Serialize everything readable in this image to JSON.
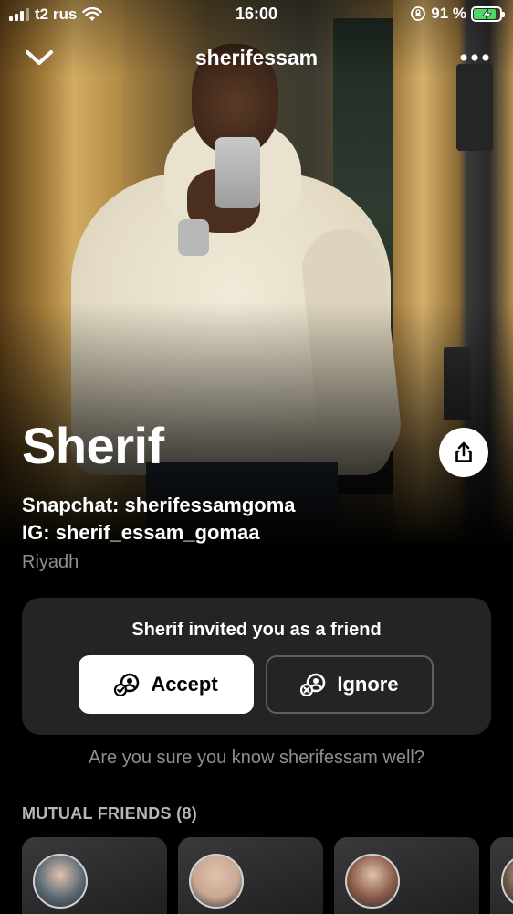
{
  "status_bar": {
    "carrier": "t2 rus",
    "time": "16:00",
    "battery_percent": "91 %",
    "battery_level": 0.91
  },
  "header": {
    "back_icon": "chevron-down-icon",
    "username": "sherifessam",
    "more_icon": "more-icon"
  },
  "profile": {
    "name": "Sherif",
    "bio_lines": [
      "Snapchat: sherifessamgoma",
      "IG: sherif_essam_gomaa"
    ],
    "location": "Riyadh",
    "share_icon": "share-icon"
  },
  "invite": {
    "title": "Sherif invited you as a friend",
    "accept_label": "Accept",
    "ignore_label": "Ignore",
    "confirm_text": "Are you sure you know sherifessam well?"
  },
  "mutual_friends": {
    "header": "MUTUAL FRIENDS (8)",
    "items": [
      {
        "avatar_color": "#5c6b74"
      },
      {
        "avatar_color": "#c9a892"
      },
      {
        "avatar_color": "#8a5a4a"
      },
      {
        "avatar_color": "#6b5a48"
      }
    ]
  }
}
